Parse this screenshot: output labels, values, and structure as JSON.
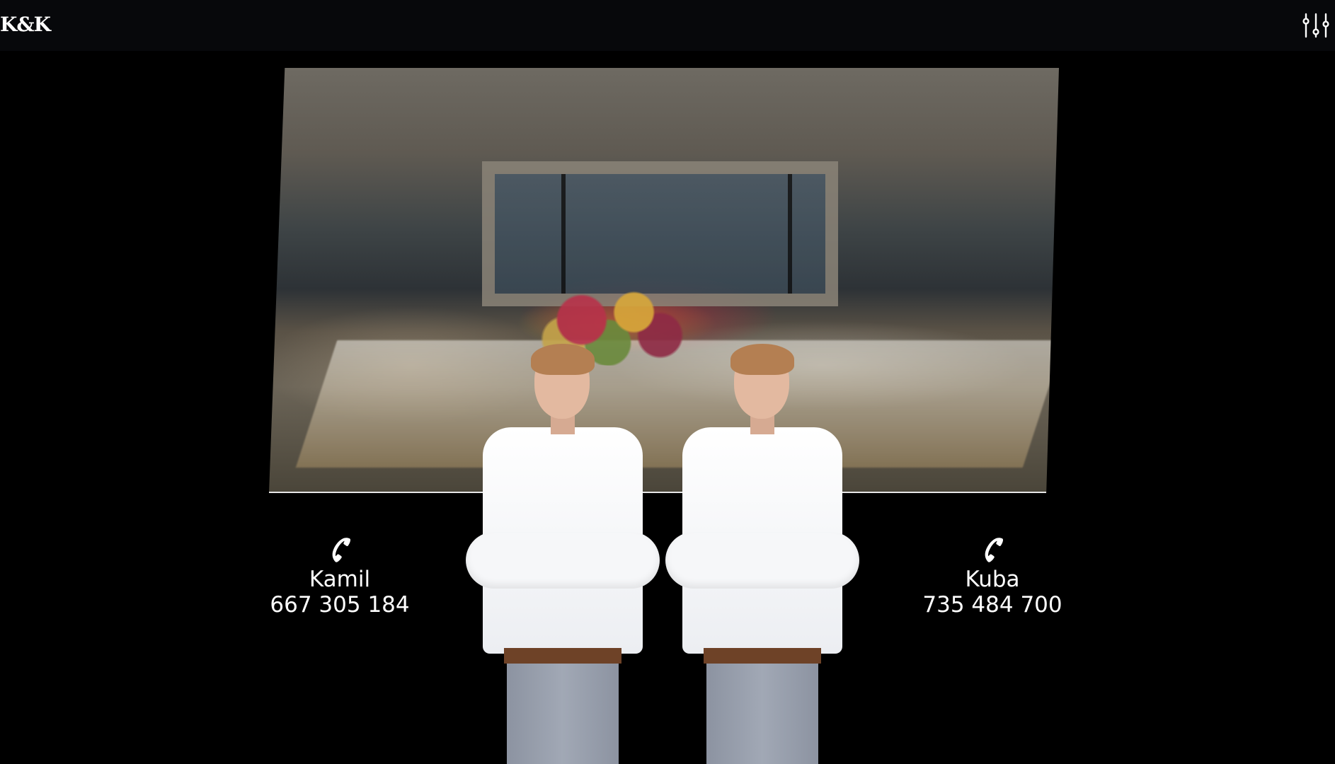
{
  "header": {
    "logo": "K&K",
    "settings_icon": "sliders-icon"
  },
  "hero": {
    "image_icon": "banquet-table-photo"
  },
  "people": {
    "image_icon": "two-men-arms-crossed-photo"
  },
  "contacts": [
    {
      "icon": "phone-icon",
      "name": "Kamil",
      "phone": "667 305 184"
    },
    {
      "icon": "phone-icon",
      "name": "Kuba",
      "phone": "735 484 700"
    }
  ],
  "colors": {
    "background": "#000000",
    "header": "#07080b",
    "text": "#ffffff"
  }
}
